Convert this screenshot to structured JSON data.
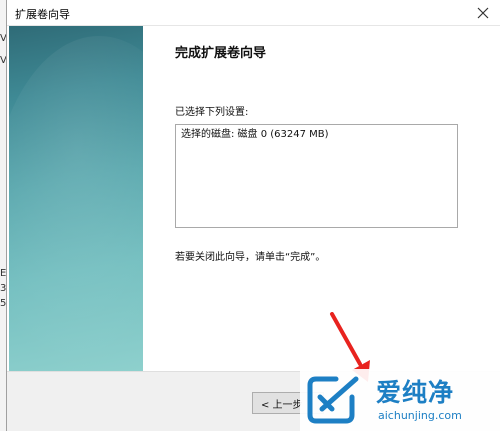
{
  "window": {
    "title": "扩展卷向导"
  },
  "page": {
    "heading": "完成扩展卷向导",
    "settings_label": "已选择下列设置:",
    "settings_lines": [
      "选择的磁盘: 磁盘 0 (63247 MB)"
    ],
    "finish_hint": "若要关闭此向导，请单击“完成”。"
  },
  "buttons": {
    "back": "< 上一步"
  },
  "background_fragments": [
    "V",
    "V",
    "E",
    "3",
    "5"
  ],
  "watermark": {
    "title": "爱纯净",
    "url": "aichunjing.com"
  },
  "colors": {
    "accent": "#1d7fc4",
    "panel_teal": "#4f9ea6",
    "annotation_arrow": "#e8231f"
  }
}
